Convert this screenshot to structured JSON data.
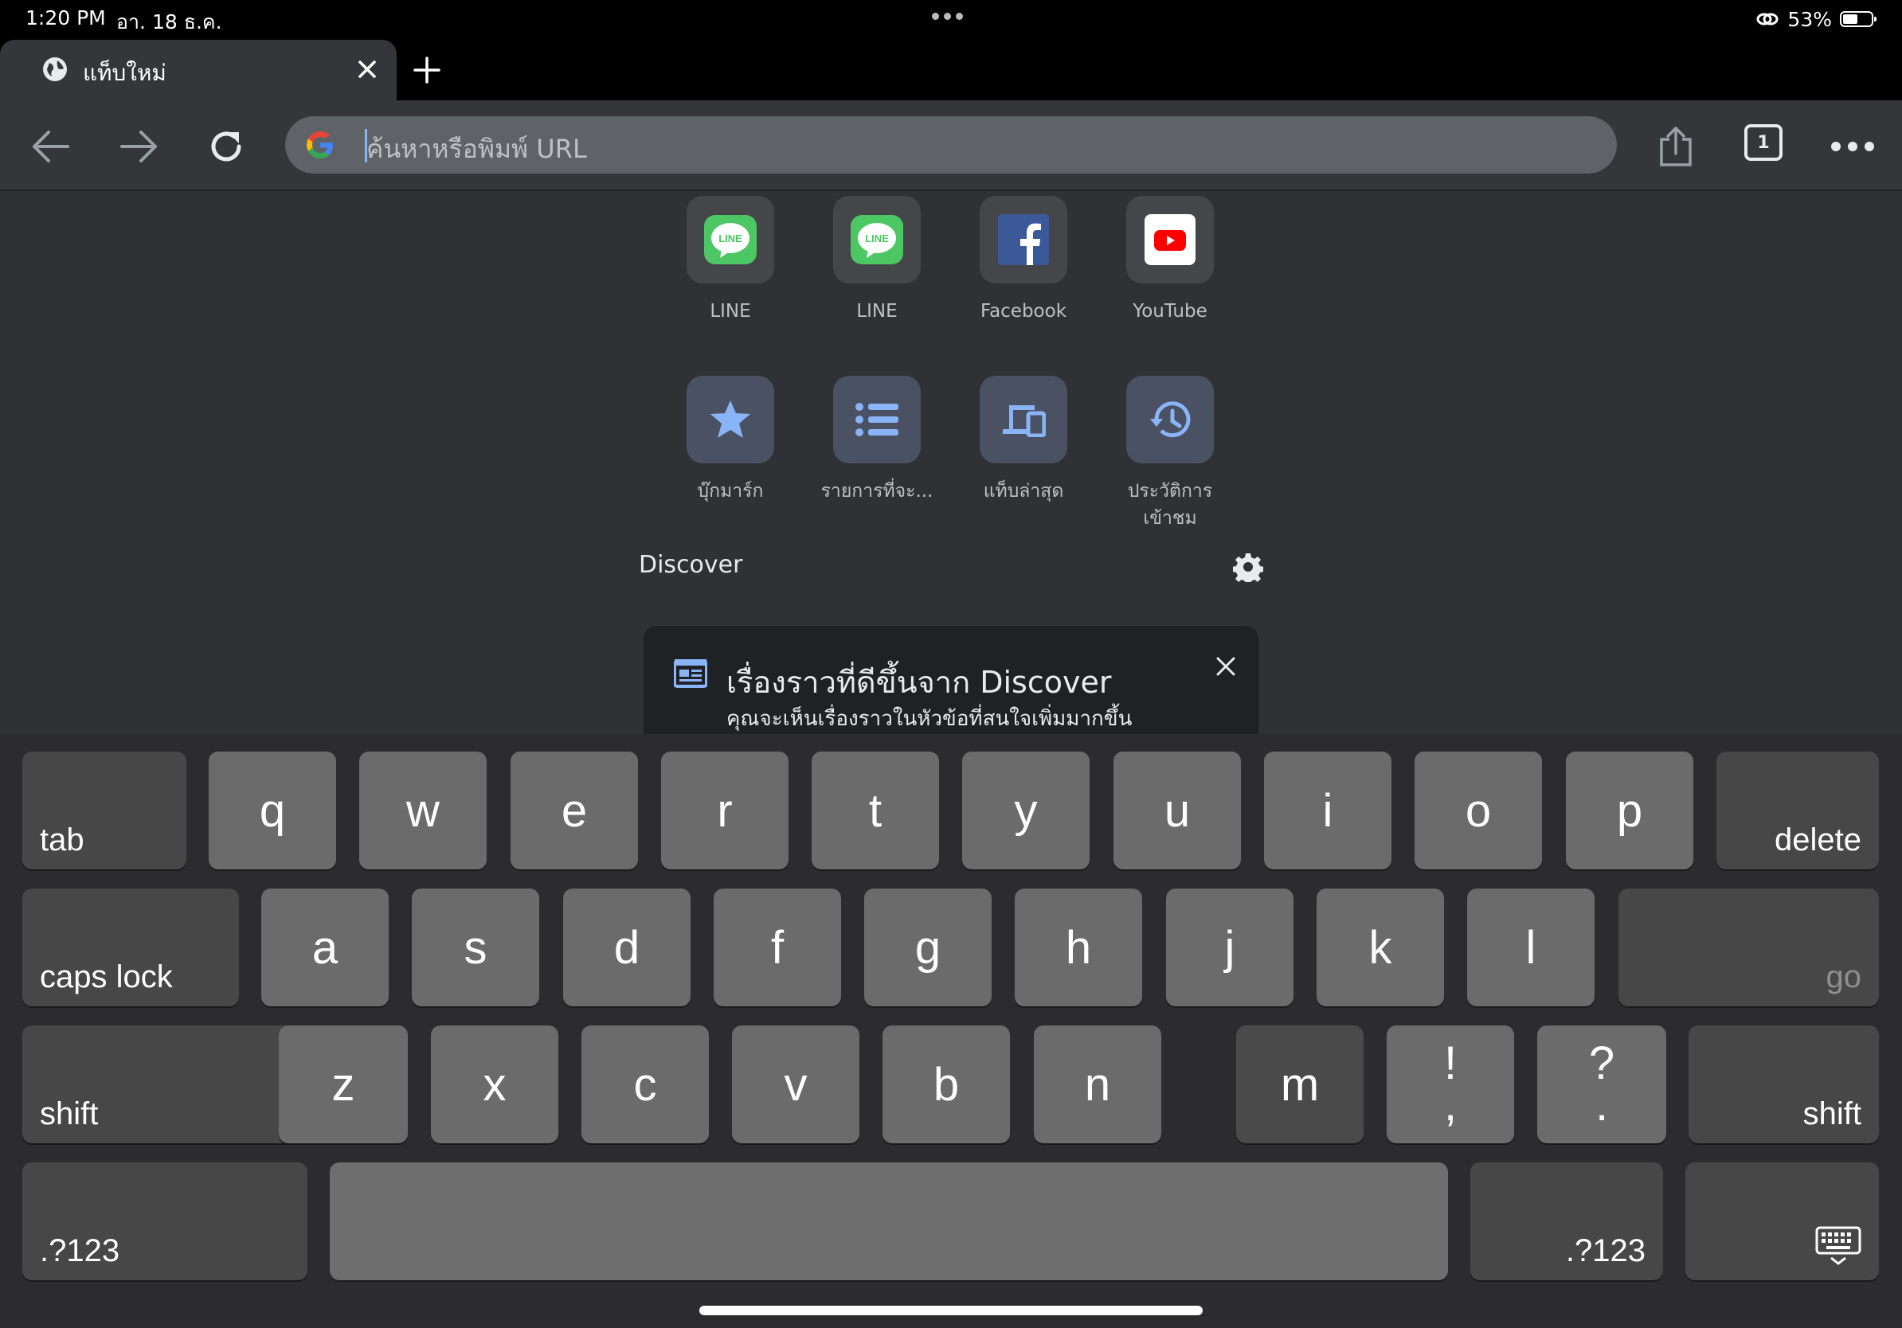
{
  "status": {
    "time": "1:20 PM",
    "date": "อา. 18 ธ.ค.",
    "battery": "53%",
    "battery_level": 0.53
  },
  "tab": {
    "title": "แท็บใหม่"
  },
  "toolbar": {
    "omnibox_placeholder": "ค้นหาหรือพิมพ์ URL",
    "tab_count": "1"
  },
  "shortcuts": [
    {
      "label": "LINE",
      "icon": "line-icon"
    },
    {
      "label": "LINE",
      "icon": "line-icon"
    },
    {
      "label": "Facebook",
      "icon": "facebook-icon"
    },
    {
      "label": "YouTube",
      "icon": "youtube-icon"
    }
  ],
  "actions": [
    {
      "label": "บุ๊กมาร์ก",
      "icon": "star-icon"
    },
    {
      "label": "รายการที่จะ...",
      "icon": "list-icon"
    },
    {
      "label": "แท็บล่าสุด",
      "icon": "devices-icon"
    },
    {
      "label": "ประวัติการ เข้าชม",
      "icon": "history-icon"
    }
  ],
  "discover": {
    "label": "Discover",
    "promo_title": "เรื่องราวที่ดีขึ้นจาก Discover",
    "promo_subtitle": "คุณจะเห็นเรื่องราวในหัวข้อที่สนใจเพิ่มมากขึ้น"
  },
  "keyboard": {
    "row1": [
      "q",
      "w",
      "e",
      "r",
      "t",
      "y",
      "u",
      "i",
      "o",
      "p"
    ],
    "row2": [
      "a",
      "s",
      "d",
      "f",
      "g",
      "h",
      "j",
      "k",
      "l"
    ],
    "row3": [
      "z",
      "x",
      "c",
      "v",
      "b",
      "n",
      "m"
    ],
    "punct1": {
      "top": "!",
      "bottom": ","
    },
    "punct2": {
      "top": "?",
      "bottom": "."
    },
    "tab": "tab",
    "delete": "delete",
    "caps_lock": "caps lock",
    "go": "go",
    "shift": "shift",
    "numbers": ".?123"
  },
  "colors": {
    "accent": "#8ab4f8",
    "background": "#303134",
    "toolbar": "#35363a"
  }
}
